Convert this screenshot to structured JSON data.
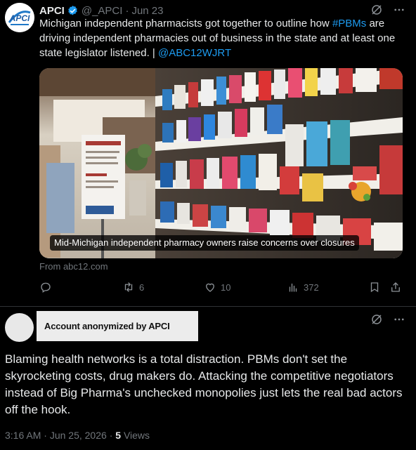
{
  "tweet": {
    "author_name": "APCI",
    "logo_text": "APCI",
    "handle": "@_APCI",
    "separator": "·",
    "date": "Jun 23",
    "text_part1": "Michigan independent pharmacists got together to outline how ",
    "hashtag": "#PBMs",
    "text_part2": " are driving independent pharmacies out of business in the state and at least one state legislator listened. | ",
    "mention": "@ABC12WJRT",
    "media_caption": "Mid-Michigan independent pharmacy owners raise concerns over closures",
    "source": "From abc12.com",
    "stats": {
      "retweets": "6",
      "likes": "10",
      "views": "372"
    }
  },
  "reply": {
    "anonymized_label": "Account anonymized by APCI",
    "text": "Blaming health networks is a total distraction. PBMs don't set the skyrocketing costs, drug makers do. Attacking the competitive negotiators instead of Big Pharma's unchecked monopolies just lets the real bad actors off the hook.",
    "time": "3:16 AM",
    "separator": "·",
    "date": "Jun 25, 2026",
    "separator2": "·",
    "views_count": "5",
    "views_label": "Views"
  },
  "icons": {
    "verified": "verified-badge-icon",
    "grok": "slash-circle-icon",
    "more": "more-dots-icon",
    "reply": "reply-icon",
    "retweet": "retweet-icon",
    "like": "heart-icon",
    "views": "bar-chart-icon",
    "bookmark": "bookmark-icon",
    "share": "share-icon"
  },
  "colors": {
    "link": "#1d9bf0",
    "muted": "#71767b",
    "text": "#e7e9ea",
    "background": "#000000"
  }
}
